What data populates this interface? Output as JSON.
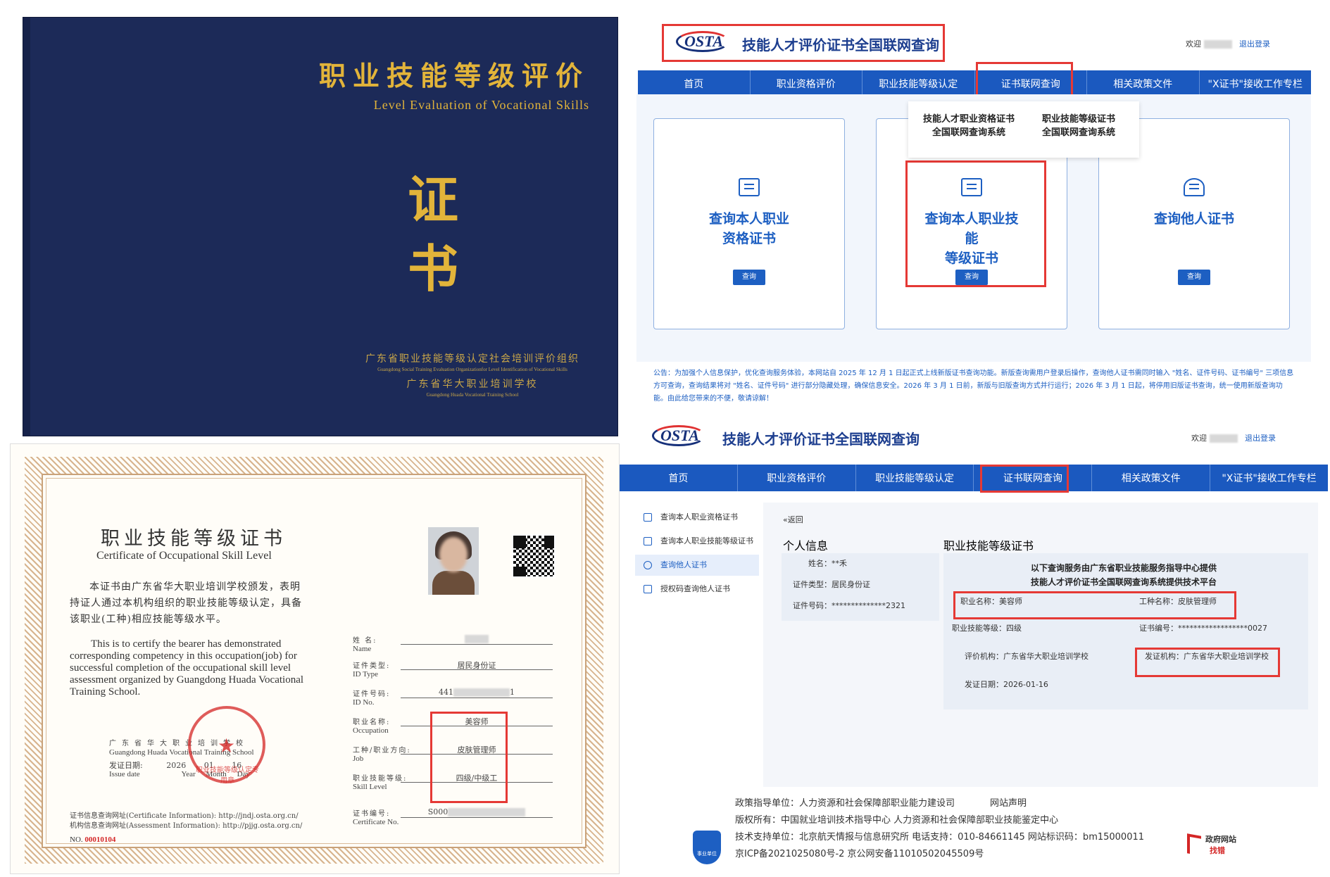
{
  "cover": {
    "title": "职业技能等级评价",
    "subtitle": "Level Evaluation of Vocational Skills",
    "big1": "证",
    "big2": "书",
    "org_cn": "广东省职业技能等级认定社会培训评价组织",
    "org_en": "Guangdong Social Training Evaluation Organizationfor Level Identification of Vocational Skills",
    "school_cn": "广东省华大职业培训学校",
    "school_en": "Guangdong Huada Vocational Training School",
    "colors": {
      "background": "#1c2a58",
      "gold": "#e2b43a"
    }
  },
  "certificate": {
    "title_cn": "职业技能等级证书",
    "title_en": "Certificate of Occupational Skill Level",
    "body_cn": "本证书由广东省华大职业培训学校颁发，表明持证人通过本机构组织的职业技能等级认定，具备该职业(工种)相应技能等级水平。",
    "body_en": "This is to certify the bearer has demonstrated corresponding competency in this occupation(job) for successful completion of the occupational skill level assessment organized by Guangdong Huada Vocational Training School.",
    "issuer_cn": "广东省华大职业培训学校",
    "issuer_en": "Guangdong Huada Vocational Training School",
    "issue_date_label": "发证日期:",
    "issue_year": "2026",
    "issue_month": "01",
    "issue_day": "16",
    "issue_date_en": "Issue date",
    "unit_year": "Year",
    "unit_month": "Month",
    "unit_day": "Day",
    "seal_text": "职业技能等级认定专用章",
    "link_cert": "证书信息查询网址(Certificate Information): http://jndj.osta.org.cn/",
    "link_assess": "机构信息查询网址(Assessment Information): http://pjjg.osta.org.cn/",
    "no_label": "NO.",
    "no_value": "00010104",
    "fields": {
      "name_label": "姓    名:",
      "name_en": "Name",
      "idtype_label": "证件类型:",
      "idtype_en": "ID Type",
      "idtype_value": "居民身份证",
      "idno_label": "证件号码:",
      "idno_en": "ID No.",
      "idno_value_start": "441",
      "idno_value_end": "1",
      "occupation_label": "职业名称:",
      "occupation_en": "Occupation",
      "occupation_value": "美容师",
      "job_label": "工种/职业方向:",
      "job_en": "Job",
      "job_value": "皮肤管理师",
      "skill_label": "职业技能等级:",
      "skill_en": "Skill Level",
      "skill_value": "四级/中级工",
      "certno_label": "证书编号:",
      "certno_en": "Certificate No.",
      "certno_value_start": "S000"
    }
  },
  "web_top": {
    "logo": "OSTA",
    "title": "技能人才评价证书全国联网查询",
    "welcome": "欢迎",
    "logout": "退出登录",
    "nav": [
      "首页",
      "职业资格评价",
      "职业技能等级认定",
      "证书联网查询",
      "相关政策文件",
      "\"X证书\"接收工作专栏"
    ],
    "dropdown": [
      {
        "line1": "技能人才职业资格证书",
        "line2": "全国联网查询系统"
      },
      {
        "line1": "职业技能等级证书",
        "line2": "全国联网查询系统"
      }
    ],
    "cards": [
      {
        "line1": "查询本人职业",
        "line2": "资格证书",
        "button": "查询",
        "icon": "certificate-icon"
      },
      {
        "line1": "查询本人职业技能",
        "line2": "等级证书",
        "button": "查询",
        "icon": "document-search-icon"
      },
      {
        "line1": "查询他人证书",
        "line2": "",
        "button": "查询",
        "icon": "user-icon"
      }
    ],
    "notice": "公告：为加强个人信息保护，优化查询服务体验，本网站自 2025 年 12 月 1 日起正式上线新版证书查询功能。新版查询需用户登录后操作，查询他人证书需同时输入 \"姓名、证件号码、证书编号\" 三项信息方可查询，查询结果将对 \"姓名、证件号码\" 进行部分隐藏处理，确保信息安全。2026 年 3 月 1 日前，新版与旧版查询方式并行运行；2026 年 3 月 1 日起，将停用旧版证书查询，统一使用新版查询功能。由此给您带来的不便，敬请谅解！"
  },
  "web_bottom": {
    "logo": "OSTA",
    "title": "技能人才评价证书全国联网查询",
    "welcome": "欢迎",
    "logout": "退出登录",
    "nav": [
      "首页",
      "职业资格评价",
      "职业技能等级认定",
      "证书联网查询",
      "相关政策文件",
      "\"X证书\"接收工作专栏"
    ],
    "side": [
      "查询本人职业资格证书",
      "查询本人职业技能等级证书",
      "查询他人证书",
      "授权码查询他人证书"
    ],
    "back": "«返回",
    "personal_header": "个人信息",
    "cert_header": "职业技能等级证书",
    "name": "姓名：**禾",
    "id_type": "证件类型：居民身份证",
    "id_no": "证件号码：**************2321",
    "provider_line1": "以下查询服务由广东省职业技能服务指导中心提供",
    "provider_line2": "技能人才评价证书全国联网查询系统提供技术平台",
    "occupation": "职业名称：美容师",
    "job": "工种名称：皮肤管理师",
    "skill": "职业技能等级：四级",
    "cert_no": "证书编号：******************0027",
    "assessor": "评价机构：广东省华大职业培训学校",
    "issuer": "发证机构：广东省华大职业培训学校",
    "issue_date": "发证日期：2026-01-16",
    "footer": {
      "guide": "政策指导单位：人力资源和社会保障部职业能力建设司",
      "statement": "网站声明",
      "copyright": "版权所有：中国就业培训技术指导中心   人力资源和社会保障部职业技能鉴定中心",
      "tech": "技术支持单位：北京航天情报与信息研究所   电话支持：010-84661145   网站标识码：bm15000011",
      "icp": "京ICP备2021025080号-2   京公网安备11010502045509号",
      "emblem": "事业单位",
      "gov1": "政府网站",
      "gov2": "找错"
    }
  },
  "highlight_color": "#e53935"
}
